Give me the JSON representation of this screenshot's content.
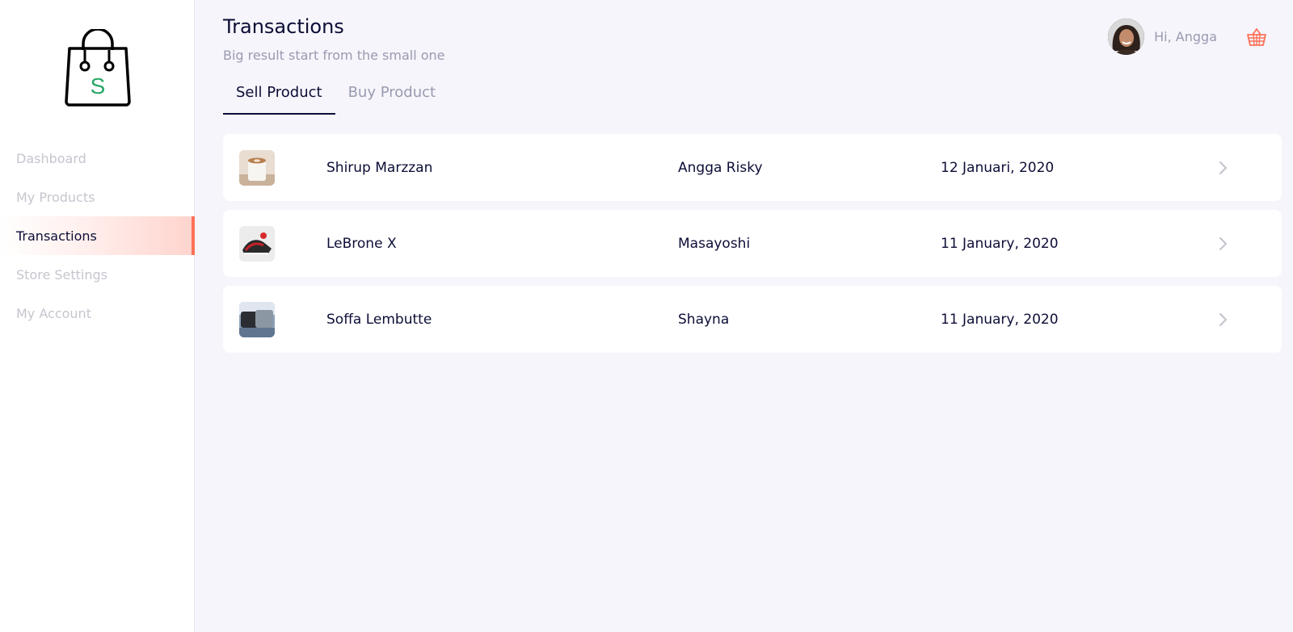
{
  "app": {
    "logo_letter": "S",
    "accent": "#ff7158"
  },
  "sidebar": {
    "items": [
      {
        "label": "Dashboard",
        "active": false
      },
      {
        "label": "My Products",
        "active": false
      },
      {
        "label": "Transactions",
        "active": true
      },
      {
        "label": "Store Settings",
        "active": false
      },
      {
        "label": "My Account",
        "active": false
      }
    ]
  },
  "header": {
    "title": "Transactions",
    "subtitle": "Big result start from the small one",
    "greeting": "Hi, Angga"
  },
  "tabs": [
    {
      "label": "Sell Product",
      "active": true
    },
    {
      "label": "Buy Product",
      "active": false
    }
  ],
  "transactions": [
    {
      "product": "Shirup Marzzan",
      "user": "Angga Risky",
      "date": "12 Januari, 2020",
      "thumb": "coffee-cup"
    },
    {
      "product": "LeBrone X",
      "user": "Masayoshi",
      "date": "11 January, 2020",
      "thumb": "sneaker"
    },
    {
      "product": "Soffa Lembutte",
      "user": "Shayna",
      "date": "11 January, 2020",
      "thumb": "sofa"
    }
  ]
}
